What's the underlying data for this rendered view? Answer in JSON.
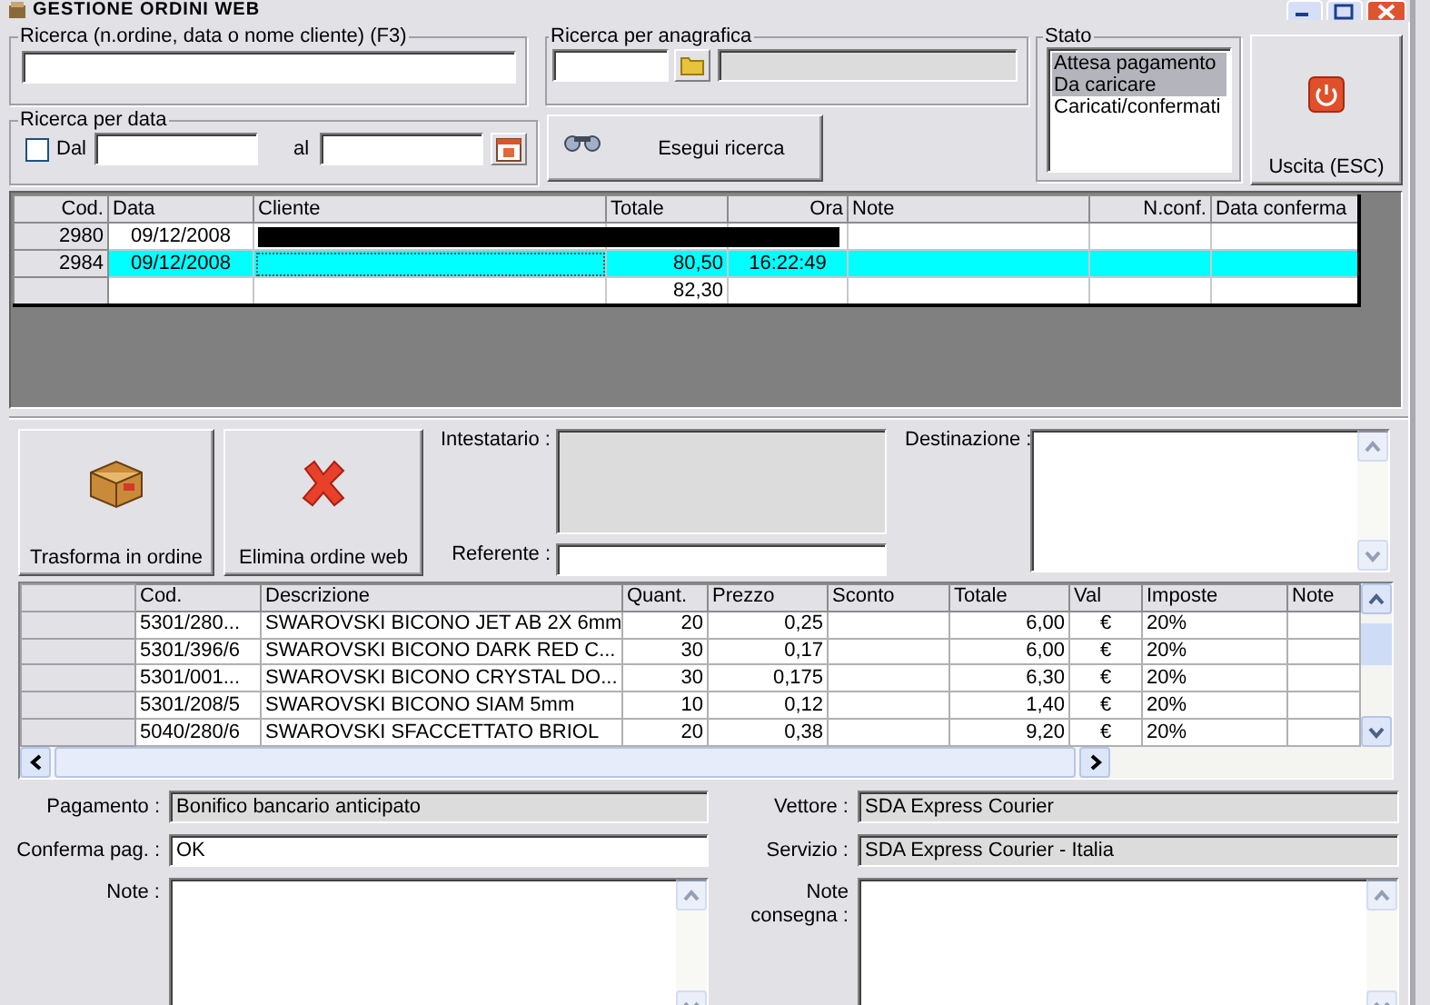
{
  "window": {
    "title": "GESTIONE ORDINI WEB"
  },
  "search": {
    "label": "Ricerca (n.ordine, data o nome cliente) (F3)"
  },
  "registry_search": {
    "label": "Ricerca per anagrafica",
    "readonly": true
  },
  "date_search": {
    "label": "Ricerca per data",
    "checkbox_label": "Dal",
    "checked": false,
    "to_label": "al"
  },
  "search_button": "Esegui ricerca",
  "status": {
    "label": "Stato",
    "items": [
      {
        "label": "Attesa pagamento",
        "selected": true
      },
      {
        "label": "Da caricare",
        "selected": true
      },
      {
        "label": "Caricati/confermati",
        "selected": false
      }
    ]
  },
  "exit_button": "Uscita (ESC)",
  "orders": {
    "columns": [
      "Cod.",
      "Data",
      "Cliente",
      "Totale",
      "Ora",
      "Note",
      "N.conf.",
      "Data conferma"
    ],
    "rows": [
      {
        "cells": [
          "2980",
          "09/12/2008",
          null,
          null,
          null,
          null,
          null,
          null
        ],
        "selected": false,
        "redacted": true
      },
      {
        "cells": [
          "2984",
          "09/12/2008",
          null,
          "80,50",
          "16:22:49",
          null,
          null,
          null
        ],
        "selected": true,
        "redacted": false
      },
      {
        "cells": [
          null,
          null,
          null,
          "82,30",
          null,
          null,
          null,
          null
        ],
        "selected": false,
        "redacted": false
      }
    ]
  },
  "actions": [
    {
      "kind": "convert",
      "label": "Trasforma in ordine"
    },
    {
      "kind": "delete",
      "label": "Elimina ordine web"
    }
  ],
  "holder": {
    "label": "Intestatario :",
    "readonly": true
  },
  "contact": {
    "label": "Referente :",
    "readonly": false
  },
  "destination": {
    "label": "Destinazione :"
  },
  "items": {
    "columns": [
      "Cod.",
      "Descrizione",
      "Quant.",
      "Prezzo",
      "Sconto",
      "Totale",
      "Val",
      "Imposte",
      "Note"
    ],
    "rows": [
      {
        "cells": [
          "5301/280...",
          "SWAROVSKI BICONO JET AB 2X 6mm",
          "20",
          "0,25",
          null,
          "6,00",
          "€",
          "20%",
          null
        ]
      },
      {
        "cells": [
          "5301/396/6",
          "SWAROVSKI BICONO DARK RED C...",
          "30",
          "0,17",
          null,
          "6,00",
          "€",
          "20%",
          null
        ]
      },
      {
        "cells": [
          "5301/001...",
          "SWAROVSKI BICONO CRYSTAL DO...",
          "30",
          "0,175",
          null,
          "6,30",
          "€",
          "20%",
          null
        ]
      },
      {
        "cells": [
          "5301/208/5",
          "SWAROVSKI BICONO SIAM 5mm",
          "10",
          "0,12",
          null,
          "1,40",
          "€",
          "20%",
          null
        ]
      },
      {
        "cells": [
          "5040/280/6",
          "SWAROVSKI SFACCETTATO BRIOL",
          "20",
          "0,38",
          null,
          "9,20",
          "€",
          "20%",
          null
        ]
      }
    ]
  },
  "payment": {
    "label": "Pagamento :",
    "value": "Bonifico bancario anticipato",
    "readonly": true
  },
  "carrier": {
    "label": "Vettore :",
    "value": "SDA Express Courier",
    "readonly": true
  },
  "payment_confirm": {
    "label": "Conferma pag. :",
    "value": "OK",
    "readonly": false
  },
  "service": {
    "label": "Servizio :",
    "value": "SDA Express Courier - Italia",
    "readonly": true
  },
  "notes": {
    "label": "Note :"
  },
  "delivery_notes": {
    "label": "Note consegna :"
  }
}
